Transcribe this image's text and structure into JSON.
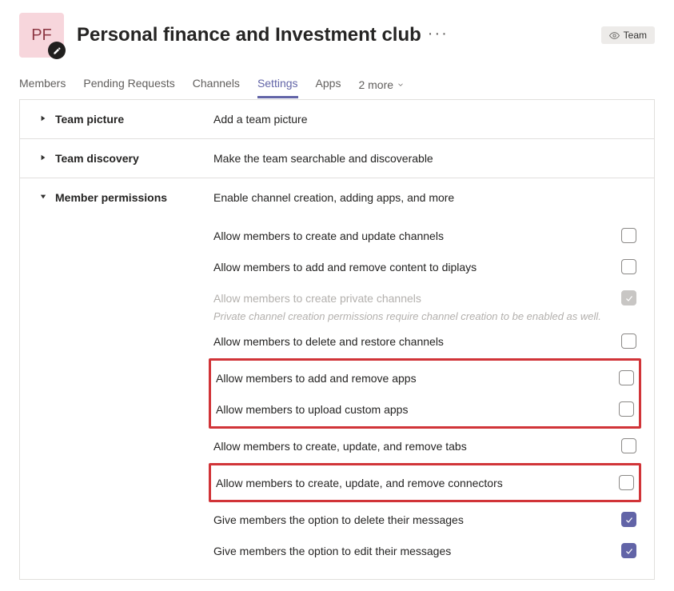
{
  "header": {
    "avatar_initials": "PF",
    "title": "Personal finance and Investment club",
    "badge_label": "Team"
  },
  "tabs": {
    "items": [
      {
        "label": "Members",
        "active": false
      },
      {
        "label": "Pending Requests",
        "active": false
      },
      {
        "label": "Channels",
        "active": false
      },
      {
        "label": "Settings",
        "active": true
      },
      {
        "label": "Apps",
        "active": false
      }
    ],
    "more_label": "2 more"
  },
  "sections": {
    "picture": {
      "title": "Team picture",
      "description": "Add a team picture"
    },
    "discovery": {
      "title": "Team discovery",
      "description": "Make the team searchable and discoverable"
    },
    "permissions": {
      "title": "Member permissions",
      "description": "Enable channel creation, adding apps, and more",
      "private_hint": "Private channel creation permissions require channel creation to be enabled as well.",
      "items": [
        {
          "label": "Allow members to create and update channels",
          "checked": false,
          "disabled": false
        },
        {
          "label": "Allow members to add and remove content to diplays",
          "checked": false,
          "disabled": false
        },
        {
          "label": "Allow members to create private channels",
          "checked": true,
          "disabled": true
        },
        {
          "label": "Allow members to delete and restore channels",
          "checked": false,
          "disabled": false
        },
        {
          "label": "Allow members to add and remove apps",
          "checked": false,
          "disabled": false
        },
        {
          "label": "Allow members to upload custom apps",
          "checked": false,
          "disabled": false
        },
        {
          "label": "Allow members to create, update, and remove tabs",
          "checked": false,
          "disabled": false
        },
        {
          "label": "Allow members to create, update, and remove connectors",
          "checked": false,
          "disabled": false
        },
        {
          "label": "Give members the option to delete their messages",
          "checked": true,
          "disabled": false
        },
        {
          "label": "Give members the option to edit their messages",
          "checked": true,
          "disabled": false
        }
      ]
    }
  }
}
